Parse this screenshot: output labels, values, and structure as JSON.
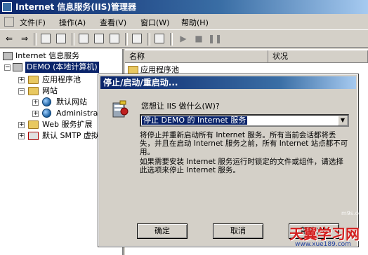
{
  "window": {
    "title": "Internet 信息服务(IIS)管理器"
  },
  "menu": [
    "文件(F)",
    "操作(A)",
    "查看(V)",
    "窗口(W)",
    "帮助(H)"
  ],
  "toolbar": {
    "back": "back-icon",
    "forward": "forward-icon",
    "up": "up-icon",
    "show_hide": "show-hide-tree-icon",
    "properties": "properties-icon",
    "refresh": "refresh-icon",
    "export": "export-icon",
    "help": "help-icon",
    "console": "console-icon",
    "play": "play-icon",
    "stop": "stop-icon",
    "pause": "pause-icon"
  },
  "tree": {
    "root": "Internet 信息服务",
    "computer": "DEMO (本地计算机)",
    "app_pools": "应用程序池",
    "websites": "网站",
    "default_site": "默认网站",
    "admin_site": "Administra",
    "web_ext": "Web 服务扩展",
    "smtp": "默认 SMTP 虚拟"
  },
  "list": {
    "col_name": "名称",
    "col_status": "状况",
    "rows": [
      "应用程序池"
    ]
  },
  "dialog": {
    "title": "停止/启动/重启动...",
    "question": "您想让 IIS 做什么(W)?",
    "selected_option": "停止 DEMO 的 Internet 服务",
    "desc1": "将停止并重新启动所有 Internet 服务。所有当前会话都将丢失，并且在启动 Internet 服务之前，所有 Internet 站点都不可用。",
    "desc2": "如果需要安装 Internet 服务运行时锁定的文件或组件，请选择此选项来停止 Internet 服务。",
    "ok": "确定",
    "cancel": "取消",
    "help": "帮助(H)"
  },
  "watermark": {
    "brand": "天翼学习网",
    "url": "www.xue189.com",
    "small": "m9s.com"
  }
}
